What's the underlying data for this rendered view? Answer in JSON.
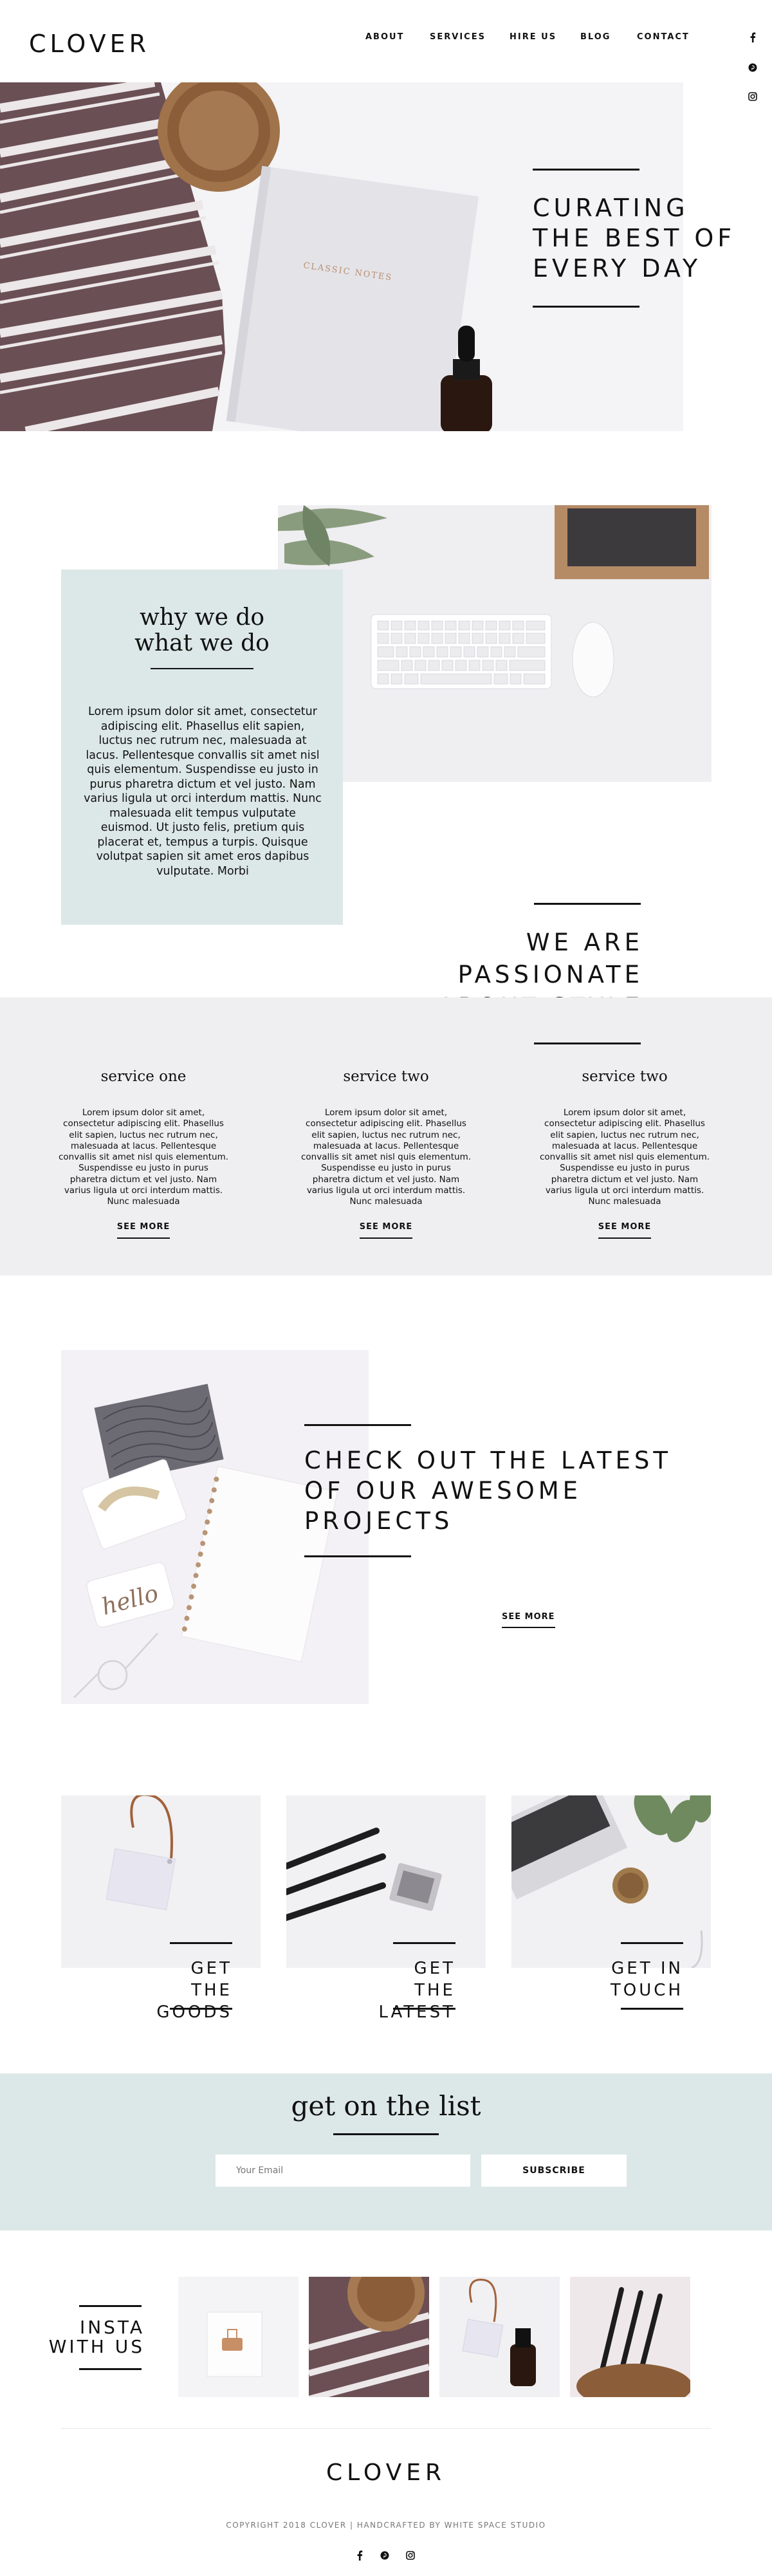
{
  "header": {
    "logo": "CLOVER",
    "nav": [
      "ABOUT",
      "SERVICES",
      "HIRE US",
      "BLOG",
      "CONTACT"
    ],
    "social": [
      "facebook-icon",
      "pinterest-icon",
      "instagram-icon"
    ]
  },
  "hero": {
    "title_lines": [
      "CURATING",
      "THE BEST OF",
      "EVERY DAY"
    ],
    "notebook_text": "CLASSIC NOTES"
  },
  "why": {
    "title_lines": [
      "why we do",
      "what we do"
    ],
    "text": "Lorem ipsum dolor sit amet, consectetur adipiscing elit. Phasellus elit sapien, luctus nec rutrum nec, malesuada at lacus. Pellentesque convallis sit amet nisl quis elementum. Suspendisse eu justo in purus pharetra dictum et vel justo. Nam varius ligula ut orci interdum mattis. Nunc malesuada elit tempus vulputate euismod. Ut justo felis, pretium quis placerat et, tempus a turpis. Quisque volutpat sapien sit amet eros dapibus vulputate. Morbi"
  },
  "passion": {
    "title_lines": [
      "WE ARE",
      "PASSIONATE",
      "ABOUT STYLE"
    ]
  },
  "services": [
    {
      "title": "service one",
      "text": "Lorem ipsum dolor sit amet, consectetur adipiscing elit. Phasellus elit sapien, luctus nec rutrum nec, malesuada at lacus. Pellentesque convallis sit amet nisl quis elementum. Suspendisse eu justo in purus pharetra dictum et vel justo. Nam varius ligula ut orci interdum mattis. Nunc malesuada",
      "more": "SEE MORE"
    },
    {
      "title": "service two",
      "text": "Lorem ipsum dolor sit amet, consectetur adipiscing elit. Phasellus elit sapien, luctus nec rutrum nec, malesuada at lacus. Pellentesque convallis sit amet nisl quis elementum. Suspendisse eu justo in purus pharetra dictum et vel justo. Nam varius ligula ut orci interdum mattis. Nunc malesuada",
      "more": "SEE MORE"
    },
    {
      "title": "service two",
      "text": "Lorem ipsum dolor sit amet, consectetur adipiscing elit. Phasellus elit sapien, luctus nec rutrum nec, malesuada at lacus. Pellentesque convallis sit amet nisl quis elementum. Suspendisse eu justo in purus pharetra dictum et vel justo. Nam varius ligula ut orci interdum mattis. Nunc malesuada",
      "more": "SEE MORE"
    }
  ],
  "projects": {
    "title_lines": [
      "CHECK OUT THE LATEST",
      "OF OUR AWESOME",
      "PROJECTS"
    ],
    "more": "SEE MORE",
    "card_text": "hello"
  },
  "cards": [
    {
      "lines": [
        "GET THE",
        "GOODS"
      ]
    },
    {
      "lines": [
        "GET THE",
        "LATEST"
      ]
    },
    {
      "lines": [
        "GET IN",
        "TOUCH"
      ]
    }
  ],
  "newsletter": {
    "title": "get on the list",
    "placeholder": "Your Email",
    "button": "SUBSCRIBE"
  },
  "insta": {
    "title_lines": [
      "INSTA",
      "WITH US"
    ]
  },
  "footer": {
    "logo": "CLOVER",
    "copyright": "COPYRIGHT 2018 CLOVER | HANDCRAFTED BY WHITE SPACE STUDIO",
    "social": [
      "facebook-icon",
      "pinterest-icon",
      "instagram-icon"
    ]
  },
  "colors": {
    "mint": "#dce8e7",
    "band_gray": "#efeff1",
    "text": "#111111"
  }
}
